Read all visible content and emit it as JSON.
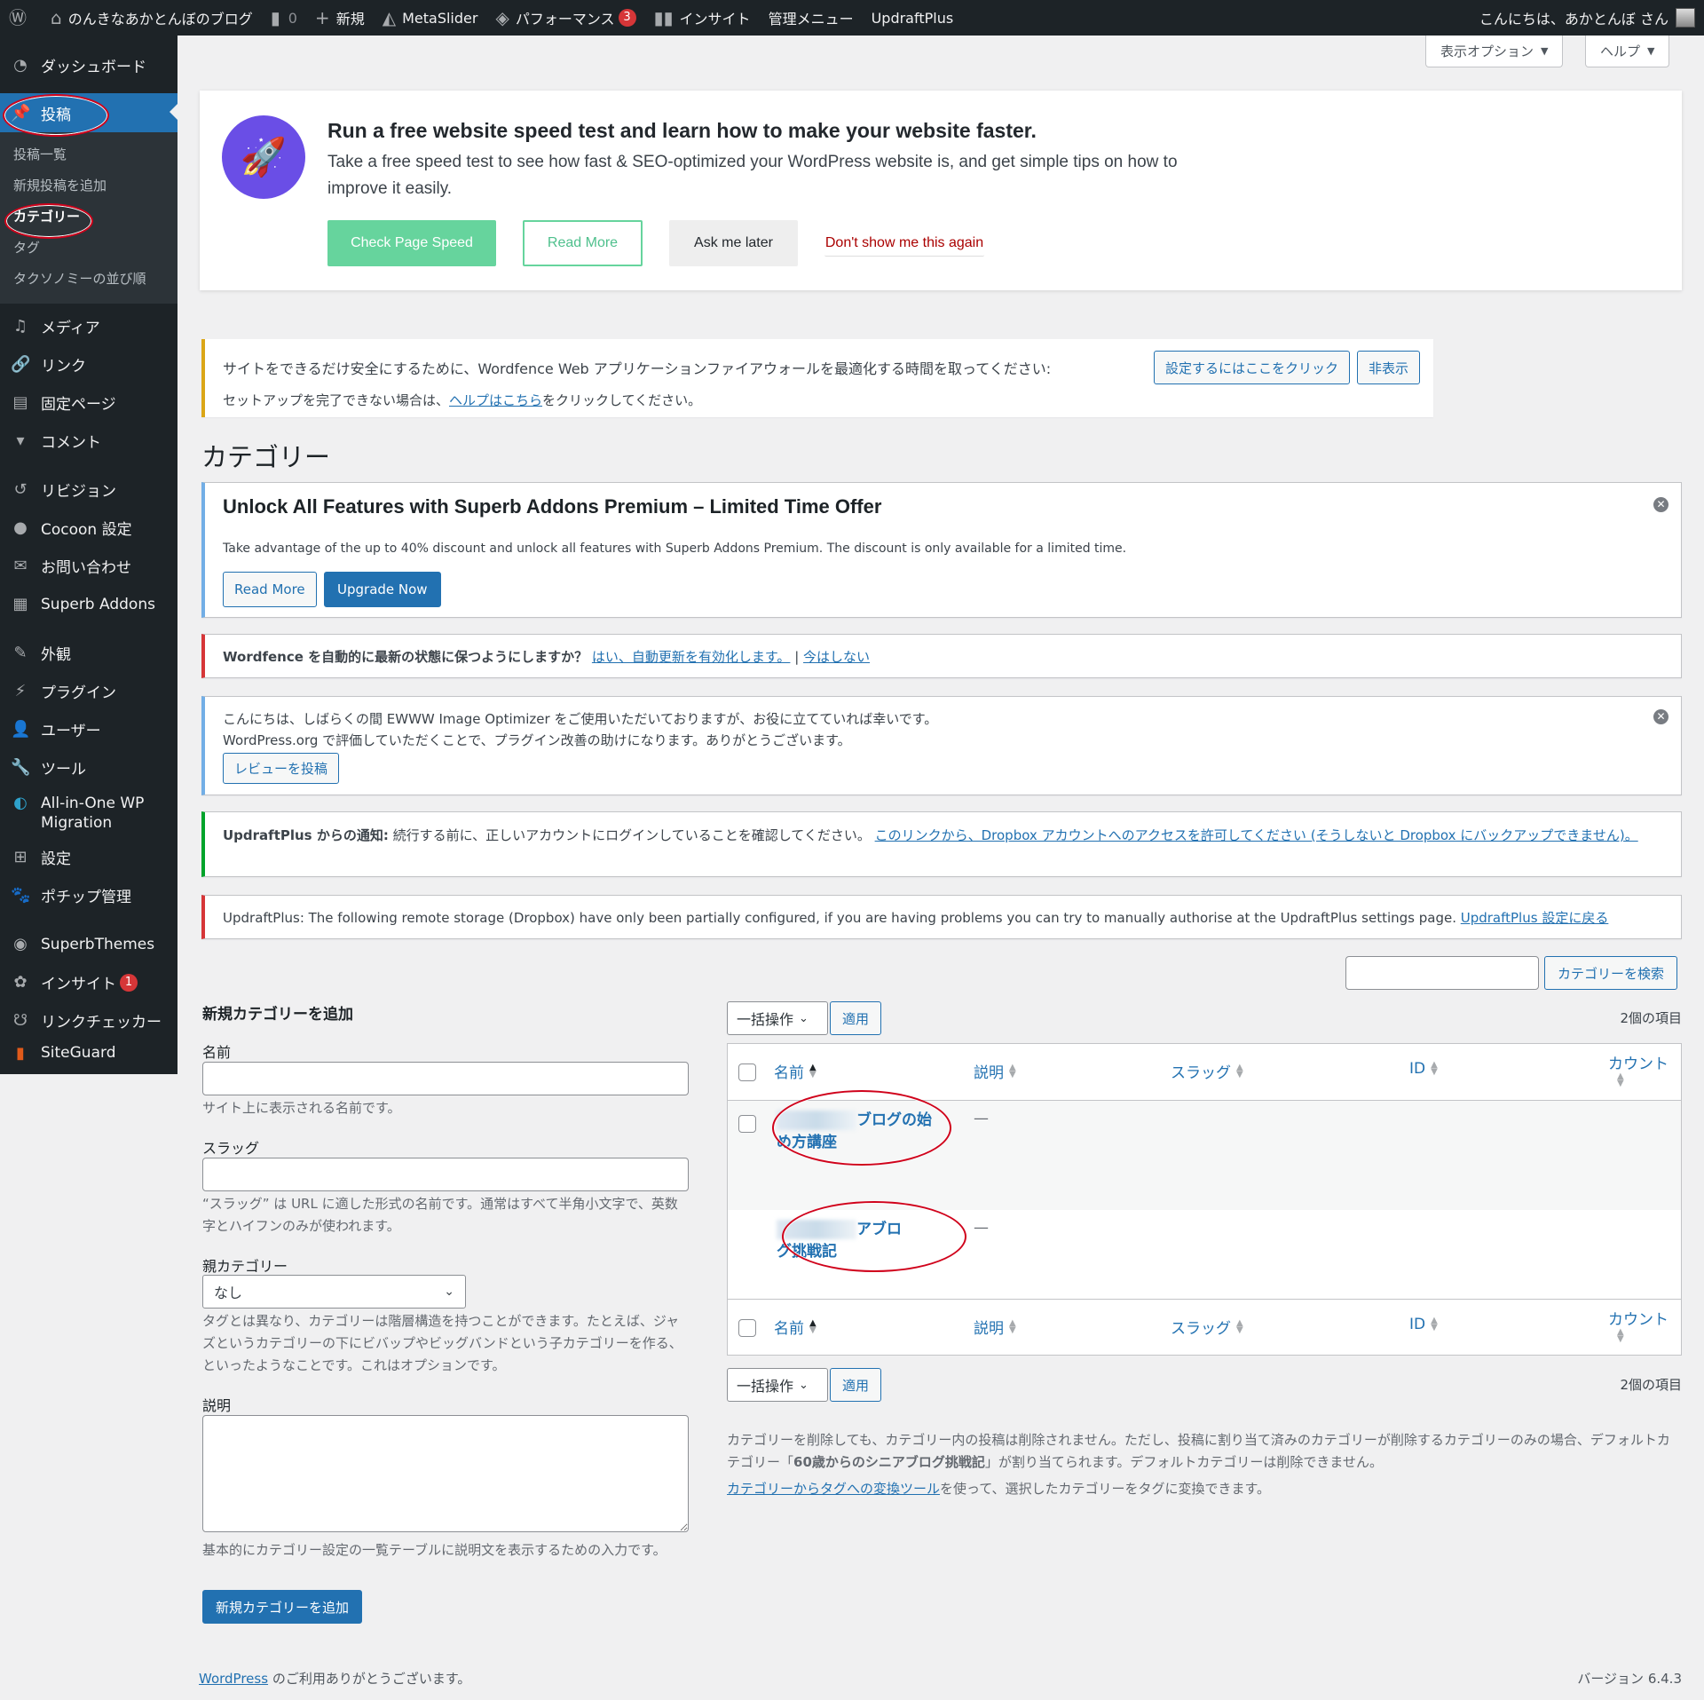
{
  "adminbar": {
    "wp_logo": "wordpress-logo",
    "site_name": "のんきなあかとんぼのブログ",
    "comments_count": "0",
    "new_label": "新規",
    "metaslider": "MetaSlider",
    "performance": "パフォーマンス",
    "performance_badge": "3",
    "insight": "インサイト",
    "admin_menu": "管理メニュー",
    "updraftplus": "UpdraftPlus",
    "greeting": "こんにちは、あかとんぼ さん"
  },
  "sidebar": {
    "items": [
      {
        "label": "ダッシュボード",
        "icon": "dashboard-icon"
      },
      {
        "label": "投稿",
        "icon": "pin-icon"
      },
      {
        "label": "メディア",
        "icon": "media-icon"
      },
      {
        "label": "リンク",
        "icon": "link-icon"
      },
      {
        "label": "固定ページ",
        "icon": "pages-icon"
      },
      {
        "label": "コメント",
        "icon": "comment-icon"
      },
      {
        "label": "リビジョン",
        "icon": "history-icon"
      },
      {
        "label": "Cocoon 設定",
        "icon": "cocoon-icon"
      },
      {
        "label": "お問い合わせ",
        "icon": "mail-icon"
      },
      {
        "label": "Superb Addons",
        "icon": "superb-addons-icon"
      },
      {
        "label": "外観",
        "icon": "brush-icon"
      },
      {
        "label": "プラグイン",
        "icon": "plugin-icon"
      },
      {
        "label": "ユーザー",
        "icon": "user-icon"
      },
      {
        "label": "ツール",
        "icon": "wrench-icon"
      },
      {
        "label": "All-in-One WP Migration",
        "icon": "migration-icon"
      },
      {
        "label": "設定",
        "icon": "settings-icon"
      },
      {
        "label": "ポチップ管理",
        "icon": "paw-icon"
      },
      {
        "label": "SuperbThemes",
        "icon": "superbthemes-icon"
      },
      {
        "label": "インサイト",
        "icon": "insight-icon",
        "badge": "1"
      },
      {
        "label": "リンクチェッカー",
        "icon": "link-checker-icon"
      },
      {
        "label": "SiteGuard",
        "icon": "siteguard-icon"
      }
    ],
    "submenu": [
      "投稿一覧",
      "新規投稿を追加",
      "カテゴリー",
      "タグ",
      "タクソノミーの並び順"
    ]
  },
  "screen_meta": {
    "options": "表示オプション",
    "help": "ヘルプ"
  },
  "speed_banner": {
    "title": "Run a free website speed test and learn how to make your website faster.",
    "body": "Take a free speed test to see how fast & SEO-optimized your WordPress website is, and get simple tips on how to improve it easily.",
    "check": "Check Page Speed",
    "read_more": "Read More",
    "later": "Ask me later",
    "dont_show": "Don't show me this again",
    "accent": "#6a4ee6",
    "green": "#66d49d"
  },
  "wordfence_waf": {
    "text": "サイトをできるだけ安全にするために、Wordfence Web アプリケーションファイアウォールを最適化する時間を取ってください:",
    "configure": "設定するにはここをクリック",
    "hide": "非表示",
    "line2_pre": "セットアップを完了できない場合は、",
    "line2_link": "ヘルプはこちら",
    "line2_post": "をクリックしてください。"
  },
  "page_title": "カテゴリー",
  "superb_notice": {
    "title": "Unlock All Features with Superb Addons Premium – Limited Time Offer",
    "body": "Take advantage of the up to 40% discount and unlock all features with Superb Addons Premium. The discount is only available for a limited time.",
    "read_more": "Read More",
    "upgrade": "Upgrade Now"
  },
  "wordfence_update": {
    "text": "Wordfence を自動的に最新の状態に保つようにしますか？",
    "yes": "はい、自動更新を有効化します。",
    "sep": "|",
    "no": "今はしない"
  },
  "ewww_notice": {
    "line1": "こんにちは、しばらくの間 EWWW Image Optimizer をご使用いただいておりますが、お役に立てていれば幸いです。",
    "line2": "WordPress.org で評価していただくことで、プラグイン改善の助けになります。ありがとうございます。",
    "review": "レビューを投稿"
  },
  "updraft_notice1": {
    "bold": "UpdraftPlus からの通知:",
    "text": " 続行する前に、正しいアカウントにログインしていることを確認してください。",
    "link": "このリンクから、Dropbox アカウントへのアクセスを許可してください (そうしないと Dropbox にバックアップできません)。"
  },
  "updraft_notice2": {
    "text": "UpdraftPlus: The following remote storage (Dropbox) have only been partially configured, if you are having problems you can try to manually authorise at the UpdraftPlus settings page. ",
    "link": "UpdraftPlus 設定に戻る"
  },
  "search": {
    "value": "",
    "button": "カテゴリーを検索"
  },
  "form": {
    "heading": "新規カテゴリーを追加",
    "name_label": "名前",
    "name_value": "",
    "name_help": "サイト上に表示される名前です。",
    "slug_label": "スラッグ",
    "slug_value": "",
    "slug_help": "“スラッグ” は URL に適した形式の名前です。通常はすべて半角小文字で、英数字とハイフンのみが使われます。",
    "parent_label": "親カテゴリー",
    "parent_value": "なし",
    "parent_help": "タグとは異なり、カテゴリーは階層構造を持つことができます。たとえば、ジャズというカテゴリーの下にビバップやビッグバンドという子カテゴリーを作る、といったようなことです。これはオプションです。",
    "desc_label": "説明",
    "desc_value": "",
    "desc_help": "基本的にカテゴリー設定の一覧テーブルに説明文を表示するための入力です。",
    "submit": "新規カテゴリーを追加"
  },
  "table": {
    "bulk_action": "一括操作",
    "apply": "適用",
    "items_count": "2個の項目",
    "columns": [
      "名前",
      "説明",
      "スラッグ",
      "ID",
      "カウント"
    ],
    "rows": [
      {
        "name_visible_line1": "ブログの始",
        "name_visible_line2": "め方講座",
        "description": "—"
      },
      {
        "name_visible_line1": "アブロ",
        "name_visible_line2": "グ挑戦記",
        "description": "—"
      }
    ]
  },
  "table_notes": {
    "line1": "カテゴリーを削除しても、カテゴリー内の投稿は削除されません。ただし、投稿に割り当て済みのカテゴリーが削除するカテゴリーのみの場合、デフォルトカテゴリー「",
    "default_category": "60歳からのシニアブログ挑戦記",
    "line1_end": "」が割り当てられます。デフォルトカテゴリーは削除できません。",
    "converter_link": "カテゴリーからタグへの変換ツール",
    "converter_text": "を使って、選択したカテゴリーをタグに変換できます。"
  },
  "footer": {
    "wp_link": "WordPress",
    "thanks": " のご利用ありがとうございます。",
    "version": "バージョン 6.4.3"
  }
}
